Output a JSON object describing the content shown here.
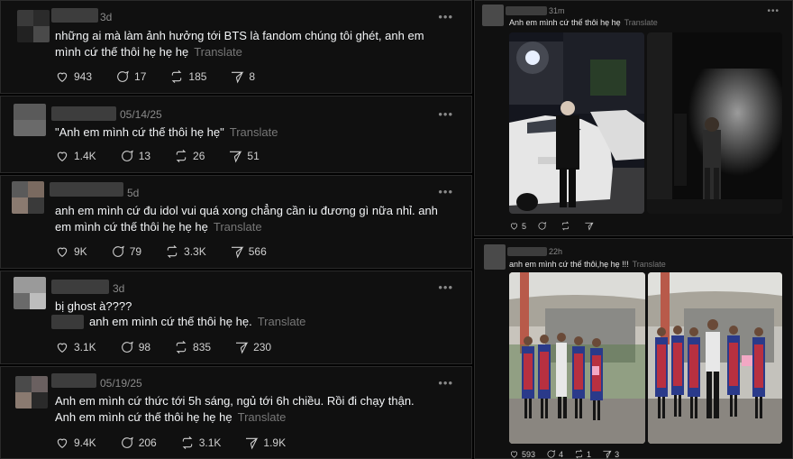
{
  "posts": [
    {
      "time": "3d",
      "text": "những ai mà làm ảnh hưởng tới BTS là fandom chúng tôi ghét, anh em mình cứ thế thôi hẹ hẹ hẹ",
      "translate": "Translate",
      "likes": "943",
      "replies": "17",
      "reposts": "185",
      "shares": "8"
    },
    {
      "time": "05/14/25",
      "text": "\"Anh em mình cứ thế thôi hẹ hẹ\"",
      "translate": "Translate",
      "likes": "1.4K",
      "replies": "13",
      "reposts": "26",
      "shares": "51"
    },
    {
      "time": "5d",
      "text": "anh em mình cứ đu idol vui quá xong chẳng cần iu đương gì nữa nhỉ. anh em mình cứ thế thôi hẹ hẹ hẹ",
      "translate": "Translate",
      "likes": "9K",
      "replies": "79",
      "reposts": "3.3K",
      "shares": "566"
    },
    {
      "time": "3d",
      "text": "bị ghost à????",
      "subtext": "anh em mình cứ thế thôi hẹ hẹ.",
      "translate": "Translate",
      "likes": "3.1K",
      "replies": "98",
      "reposts": "835",
      "shares": "230"
    },
    {
      "time": "05/19/25",
      "text": "Anh em mình cứ thức tới 5h sáng, ngủ tới 6h chiều. Rồi đi chạy thận. Anh em mình cứ thế thôi hẹ hẹ hẹ",
      "translate": "Translate",
      "likes": "9.4K",
      "replies": "206",
      "reposts": "3.1K",
      "shares": "1.9K"
    }
  ],
  "right_posts": [
    {
      "time": "31m",
      "text": "Anh em mình cứ thế thôi hẹ hẹ",
      "translate": "Translate",
      "likes": "5",
      "replies": "",
      "reposts": "",
      "shares": ""
    },
    {
      "time": "22h",
      "text": "anh em mình cứ thế thôi,hẹ hẹ !!!",
      "translate": "Translate",
      "likes": "593",
      "replies": "4",
      "reposts": "1",
      "shares": "3"
    }
  ],
  "more_label": "•••",
  "colors": {
    "background": "#000000",
    "card": "#101010",
    "border": "#2a2a2a",
    "muted": "#8a8a8a"
  },
  "icons": [
    "heart-icon",
    "comment-icon",
    "repost-icon",
    "share-icon",
    "more-icon"
  ]
}
